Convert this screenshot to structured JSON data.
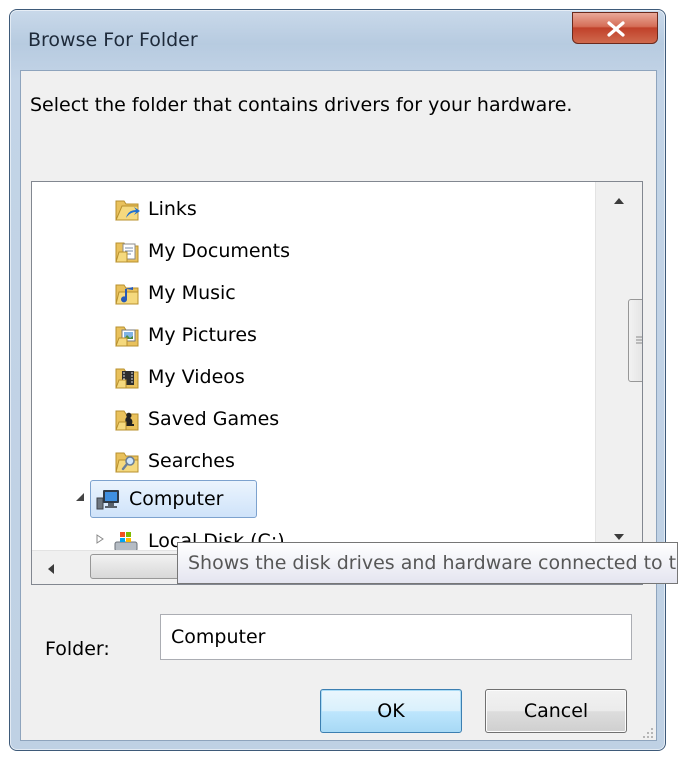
{
  "window": {
    "title": "Browse For Folder"
  },
  "dialog": {
    "instruction": "Select the folder that contains drivers for your hardware.",
    "folder_label": "Folder:",
    "folder_value": "Computer",
    "ok_label": "OK",
    "cancel_label": "Cancel"
  },
  "tree": {
    "items": [
      {
        "label": "Links",
        "icon": "links-folder-icon"
      },
      {
        "label": "My Documents",
        "icon": "documents-folder-icon"
      },
      {
        "label": "My Music",
        "icon": "music-folder-icon"
      },
      {
        "label": "My Pictures",
        "icon": "pictures-folder-icon"
      },
      {
        "label": "My Videos",
        "icon": "videos-folder-icon"
      },
      {
        "label": "Saved Games",
        "icon": "saved-games-folder-icon"
      },
      {
        "label": "Searches",
        "icon": "searches-folder-icon"
      },
      {
        "label": "Computer",
        "icon": "computer-icon",
        "selected": true,
        "expanded": true
      },
      {
        "label": "Local Disk (C:)",
        "icon": "local-disk-icon"
      }
    ]
  },
  "tooltip": {
    "text": "Shows the disk drives and hardware connected to this computer."
  },
  "colors": {
    "selection": "#cfe3fa",
    "close_button": "#c0412a",
    "accent_border": "#3c7fb1"
  }
}
